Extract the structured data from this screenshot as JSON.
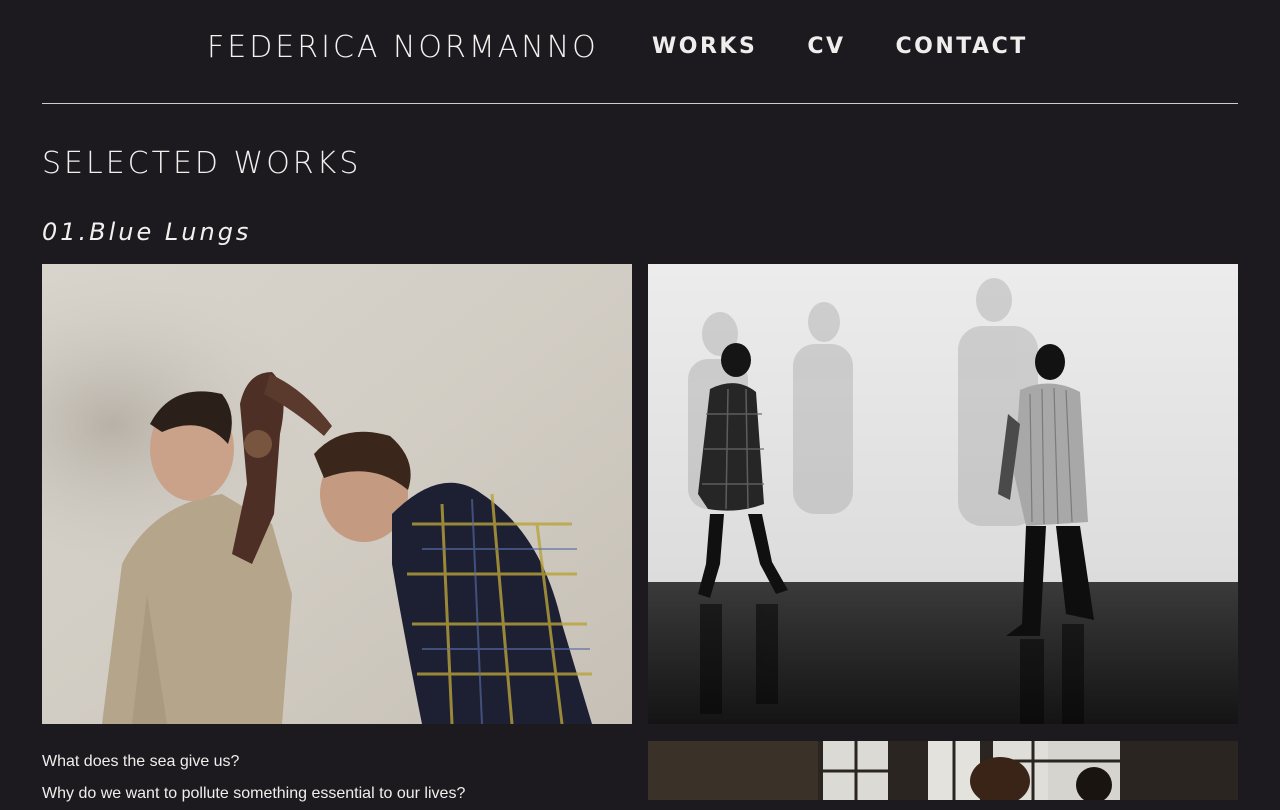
{
  "header": {
    "brand": "FEDERICA NORMANNO",
    "nav": [
      "WORKS",
      "CV",
      "CONTACT"
    ]
  },
  "main": {
    "section_title": "SELECTED WORKS",
    "work": {
      "title": "01.Blue Lungs",
      "description_lines": [
        "What does the sea give us?",
        "Why do we want to pollute something essential to our lives?"
      ],
      "images": [
        "two-dancers-color-photo",
        "dancers-against-wall-bw-photo",
        "dancers-by-window-photo"
      ]
    }
  },
  "colors": {
    "background": "#1c1a1e",
    "text": "#f2f0ee",
    "divider": "#cfcdcc"
  }
}
